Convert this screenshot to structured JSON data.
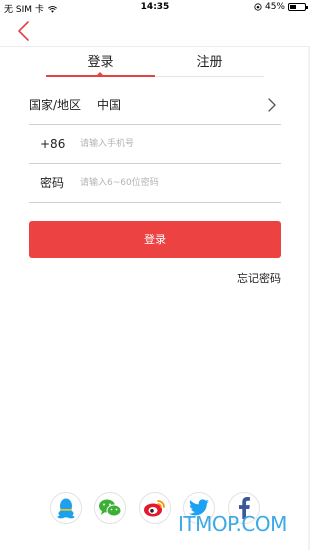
{
  "status_bar": {
    "carrier": "无 SIM 卡",
    "time": "14:35",
    "battery_text": "45%",
    "battery_level": 0.45
  },
  "nav": {
    "back_icon": "chevron-left-icon",
    "accent_color": "#e44343"
  },
  "tabs": [
    {
      "label": "登录",
      "active": true
    },
    {
      "label": "注册",
      "active": false
    }
  ],
  "form": {
    "region_label": "国家/地区",
    "region_value": "中国",
    "phone_prefix": "+86",
    "phone_placeholder": "请输入手机号",
    "password_label": "密码",
    "password_placeholder": "请输入6~60位密码"
  },
  "login_button_label": "登录",
  "login_button_color": "#ec4242",
  "forgot_password_label": "忘记密码",
  "social": [
    {
      "name": "qq-icon",
      "color": "#1ea0f0"
    },
    {
      "name": "wechat-icon",
      "color": "#3cb034"
    },
    {
      "name": "weibo-icon",
      "color": "#e6162d"
    },
    {
      "name": "twitter-icon",
      "color": "#1da1f2"
    },
    {
      "name": "facebook-icon",
      "color": "#3b5998"
    }
  ],
  "watermark": "ITMOP.COM"
}
